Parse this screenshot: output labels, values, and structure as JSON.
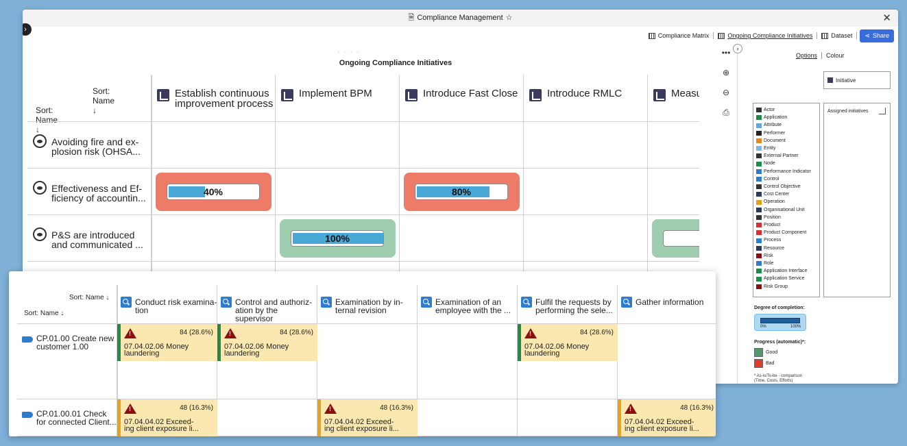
{
  "window": {
    "title": "Compliance Management",
    "star": "☆",
    "close": "✕"
  },
  "toolbar": {
    "compliance_matrix": "Compliance Matrix",
    "ongoing": "Ongoing Compliance Initiatives",
    "dataset": "Dataset",
    "share": "Share"
  },
  "matrix": {
    "title": "Ongoing Compliance Initiatives",
    "sort_cols": "Sort: Name",
    "sort_rows": "Sort: Name",
    "columns": [
      "Establish continuous improvement process",
      "Implement BPM",
      "Introduce Fast Close",
      "Introduce RMLC",
      "Measure core p"
    ],
    "rows": [
      {
        "label": "Avoiding fire and explosion risk (OHSA...",
        "line1": "Avoiding fire and ex-",
        "line2": "plosion risk (OHSA..."
      },
      {
        "label": "Effectiveness and Efficiency of accountin...",
        "line1": "Effectiveness and Ef-",
        "line2": "ficiency of accountin..."
      },
      {
        "label": "P&S are introduced and communicated ...",
        "line1": "P&S are introduced",
        "line2": "and communicated ..."
      }
    ],
    "cells": [
      {
        "row": 1,
        "col": 0,
        "pct": "40%",
        "value": 0.4,
        "status": "bad",
        "color": "#ee7a68"
      },
      {
        "row": 1,
        "col": 2,
        "pct": "80%",
        "value": 0.8,
        "status": "bad",
        "color": "#ee7a68"
      },
      {
        "row": 2,
        "col": 1,
        "pct": "100%",
        "value": 1.0,
        "status": "good",
        "color": "#9fcdaf"
      }
    ]
  },
  "side_tools": [
    "more-icon",
    "zoom-in-icon",
    "zoom-out-icon",
    "export-icon"
  ],
  "panel": {
    "tab_options": "Options",
    "tab_colour": "Colour",
    "initiative": "Initiative",
    "assigned": "Assigned initiatives",
    "legend": [
      {
        "label": "Actor",
        "color": "#333"
      },
      {
        "label": "Application",
        "color": "#1f8a4c"
      },
      {
        "label": "Attribute",
        "color": "#6aa3d8"
      },
      {
        "label": "Performer",
        "color": "#222"
      },
      {
        "label": "Document",
        "color": "#e08a1e"
      },
      {
        "label": "Entity",
        "color": "#7fb6e6"
      },
      {
        "label": "External Partner",
        "color": "#333"
      },
      {
        "label": "Node",
        "color": "#1f8a4c"
      },
      {
        "label": "Performance Indicator",
        "color": "#2e7cd0"
      },
      {
        "label": "Control",
        "color": "#2e7cd0"
      },
      {
        "label": "Control Objective",
        "color": "#333"
      },
      {
        "label": "Cost Center",
        "color": "#2a3a5c"
      },
      {
        "label": "Operation",
        "color": "#e0a21e"
      },
      {
        "label": "Organisational Unit",
        "color": "#2a3a5c"
      },
      {
        "label": "Position",
        "color": "#333"
      },
      {
        "label": "Product",
        "color": "#d83030"
      },
      {
        "label": "Product Component",
        "color": "#d83030"
      },
      {
        "label": "Process",
        "color": "#2e7cd0"
      },
      {
        "label": "Resource",
        "color": "#2a3a5c"
      },
      {
        "label": "Risk",
        "color": "#8a1010"
      },
      {
        "label": "Role",
        "color": "#2e7cd0"
      },
      {
        "label": "Application Interface",
        "color": "#1f8a4c"
      },
      {
        "label": "Application Service",
        "color": "#1f8a4c"
      },
      {
        "label": "Risk Group",
        "color": "#8a1010"
      }
    ],
    "degree_title": "Degree of completion:",
    "deg_min": "0%",
    "deg_max": "100%",
    "progress_title": "Progress (automatic)*:",
    "good": "Good",
    "bad": "Bad",
    "good_color": "#4e9a6a",
    "bad_color": "#e03a2a",
    "note1": "* As-is/To-be - comparison",
    "note2": "(Time, Costs, Efforts)"
  },
  "overlay": {
    "sort_cols": "Sort: Name",
    "sort_rows": "Sort: Name",
    "columns": [
      {
        "l1": "Conduct risk examina-",
        "l2": "tion"
      },
      {
        "l1": "Control and authoriz-",
        "l2": "ation by the supervisor"
      },
      {
        "l1": "Examination by in-",
        "l2": "ternal revision"
      },
      {
        "l1": "Examination of an",
        "l2": "employee with the ..."
      },
      {
        "l1": "Fulfil the requests by",
        "l2": "performing the sele..."
      },
      {
        "l1": "Gather information",
        "l2": ""
      }
    ],
    "rows": [
      {
        "l1": "CP.01.00 Create new",
        "l2": "customer 1.00"
      },
      {
        "l1": "CP.01.00.01 Check",
        "l2": "for connected Client..."
      }
    ],
    "risk_a": {
      "num": "84 (28.6%)",
      "l1": "07.04.02.06 Money",
      "l2": "laundering",
      "stripe": "#1f8a4c"
    },
    "risk_b": {
      "num": "48 (16.3%)",
      "l1": "07.04.04.02 Exceed-",
      "l2": "ing client exposure li...",
      "stripe": "#e8a21e"
    }
  }
}
